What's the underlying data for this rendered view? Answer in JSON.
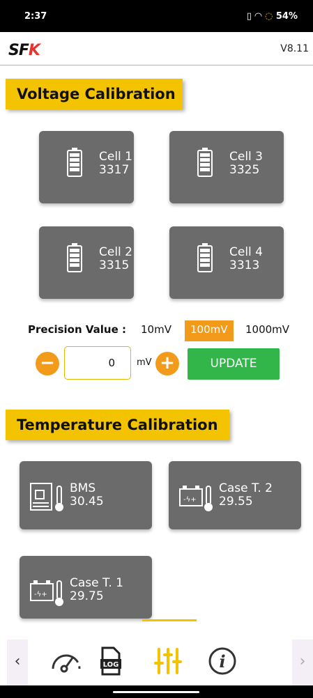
{
  "status": {
    "time": "2:37",
    "battery": "54%"
  },
  "header": {
    "version": "V8.11"
  },
  "voltage": {
    "title": "Voltage Calibration",
    "cells": [
      {
        "name": "Cell 1",
        "value": "3317"
      },
      {
        "name": "Cell 3",
        "value": "3325"
      },
      {
        "name": "Cell 2",
        "value": "3315"
      },
      {
        "name": "Cell 4",
        "value": "3313"
      }
    ],
    "precision_label": "Precision Value :",
    "options": [
      "10mV",
      "100mV",
      "1000mV"
    ],
    "selected_option": "100mV",
    "input_value": "0",
    "unit": "mV",
    "update_label": "UPDATE"
  },
  "temperature": {
    "title": "Temperature Calibration",
    "sensors": [
      {
        "name": "BMS",
        "value": "30.45"
      },
      {
        "name": "Case T. 2",
        "value": "29.55"
      },
      {
        "name": "Case T. 1",
        "value": "29.75"
      }
    ]
  },
  "nav": {
    "log_label": "LOG",
    "active": "settings"
  }
}
